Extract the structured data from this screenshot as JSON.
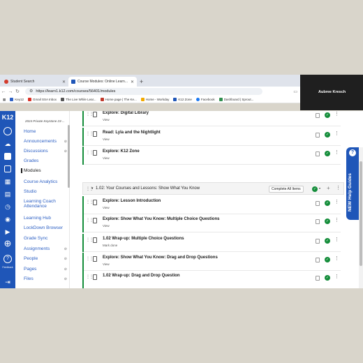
{
  "tabs": [
    {
      "label": "Student Search",
      "active": false,
      "favicon_color": "#d33b2c"
    },
    {
      "label": "Course Modules: Online Learn...",
      "active": true,
      "favicon_color": "#1f56b8"
    }
  ],
  "address_bar": {
    "url": "https://learn1.k12.com/courses/56401/modules"
  },
  "bookmarks": [
    {
      "label": "Key12",
      "color": "#2d60c4"
    },
    {
      "label": "Gmail SSA Inbox",
      "color": "#d93025"
    },
    {
      "label": "The Live While Lear...",
      "color": "#555555"
    },
    {
      "label": "Home page | The Ke...",
      "color": "#c0392b"
    },
    {
      "label": "Home - Workday",
      "color": "#f2a900"
    },
    {
      "label": "K12 Zone",
      "color": "#1f56b8"
    },
    {
      "label": "Facebook",
      "color": "#1877f2"
    },
    {
      "label": "Dashboard | Sprout...",
      "color": "#2f8f4e"
    }
  ],
  "video": {
    "name": "Aubree Kresch"
  },
  "global_nav": {
    "logo": "K12",
    "feedback_label": "Feedback"
  },
  "course_nav": {
    "course_title": "2024 Private Keystone 23-...",
    "items": [
      {
        "label": "Home",
        "hidden": false,
        "active": false
      },
      {
        "label": "Announcements",
        "hidden": true,
        "active": false
      },
      {
        "label": "Discussions",
        "hidden": true,
        "active": false
      },
      {
        "label": "Grades",
        "hidden": false,
        "active": false
      },
      {
        "label": "Modules",
        "hidden": false,
        "active": true
      },
      {
        "label": "Course Analytics",
        "hidden": false,
        "active": false
      },
      {
        "label": "Studio",
        "hidden": false,
        "active": false
      },
      {
        "label": "Learning Coach Attendance",
        "hidden": false,
        "active": false
      },
      {
        "label": "Learning Hub",
        "hidden": false,
        "active": false
      },
      {
        "label": "LockDown Browser",
        "hidden": false,
        "active": false
      },
      {
        "label": "Grade Sync",
        "hidden": false,
        "active": false
      },
      {
        "label": "Assignments",
        "hidden": true,
        "active": false
      },
      {
        "label": "People",
        "hidden": true,
        "active": false
      },
      {
        "label": "Pages",
        "hidden": true,
        "active": false
      },
      {
        "label": "Files",
        "hidden": true,
        "active": false
      }
    ]
  },
  "modules": {
    "top_items": [
      {
        "title": "Explore: Digital Library",
        "sub": "View"
      },
      {
        "title": "Read: Lyla and the Nightlight",
        "sub": "View"
      },
      {
        "title": "Explore: K12 Zone",
        "sub": "View"
      }
    ],
    "section": {
      "title": "1.02: Your Courses and Lessons: Show What You Know",
      "complete_all_label": "Complete All Items"
    },
    "section_items": [
      {
        "title": "Explore: Lesson Introduction",
        "sub": "View"
      },
      {
        "title": "Explore: Show What You Know: Multiple Choice Questions",
        "sub": "View"
      },
      {
        "title": "1.02 Wrap-up: Multiple Choice Questions",
        "sub": "Mark done"
      },
      {
        "title": "Explore: Show What You Know: Drag and Drop Questions",
        "sub": "View"
      },
      {
        "title": "1.02 Wrap-up: Drag and Drop Question",
        "sub": ""
      }
    ]
  },
  "help_tab": {
    "label": "NEW Help Guides"
  }
}
